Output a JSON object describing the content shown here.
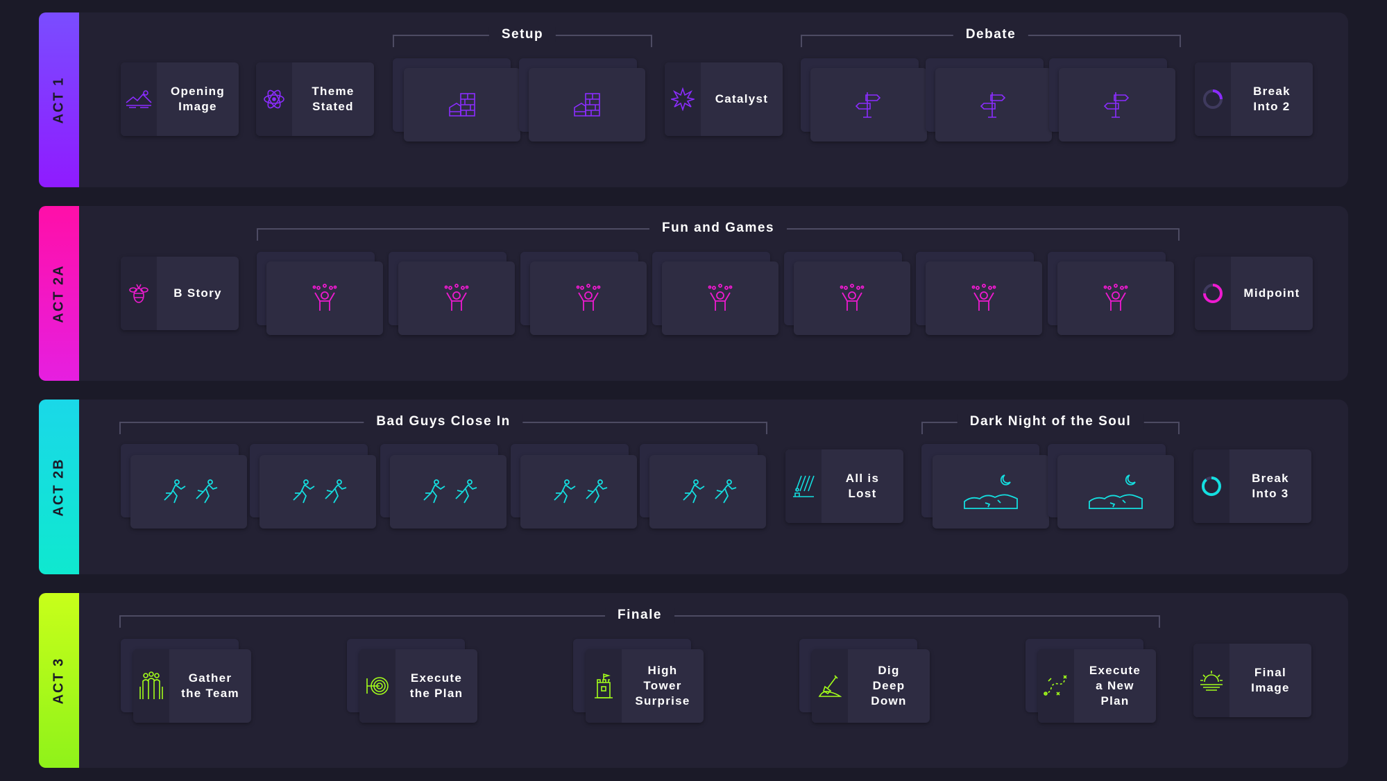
{
  "colors": {
    "background": "#1b1a28",
    "panel": "#232133",
    "card": "#2e2c42",
    "act1": "#8b2cff",
    "act2a": "#ee1ad0",
    "act2b": "#14dfe0",
    "act3": "#a3ff1a"
  },
  "acts": [
    {
      "label": "ACT 1"
    },
    {
      "label": "ACT 2A"
    },
    {
      "label": "ACT 2B"
    },
    {
      "label": "ACT 3"
    }
  ],
  "act1": {
    "groups": {
      "setup": "Setup",
      "debate": "Debate"
    },
    "beats": {
      "opening_image": "Opening\nImage",
      "theme_stated": "Theme\nStated",
      "catalyst": "Catalyst",
      "break_into_2": "Break\nInto 2"
    },
    "icons": {
      "opening_image": "landscape-icon",
      "theme_stated": "atom-icon",
      "setup": "bricks-icon",
      "catalyst": "burst-icon",
      "debate": "signpost-icon",
      "break_into_2": "ring-icon"
    }
  },
  "act2a": {
    "groups": {
      "fun_and_games": "Fun and Games"
    },
    "beats": {
      "b_story": "B Story",
      "midpoint": "Midpoint"
    },
    "icons": {
      "b_story": "bee-icon",
      "fun_and_games": "celebrating-person-icon",
      "midpoint": "ring-icon"
    }
  },
  "act2b": {
    "groups": {
      "bad_guys": "Bad Guys Close In",
      "dark_night": "Dark Night of the Soul"
    },
    "beats": {
      "all_is_lost": "All is\nLost",
      "break_into_3": "Break\nInto 3"
    },
    "icons": {
      "bad_guys": "running-figures-icon",
      "all_is_lost": "rain-person-icon",
      "dark_night": "moon-desert-icon",
      "break_into_3": "ring-icon"
    }
  },
  "act3": {
    "groups": {
      "finale": "Finale"
    },
    "beats": {
      "gather_the_team": "Gather\nthe Team",
      "execute_the_plan": "Execute\nthe Plan",
      "high_tower_surprise": "High\nTower\nSurprise",
      "dig_deep_down": "Dig\nDeep\nDown",
      "execute_new_plan": "Execute\na New\nPlan",
      "final_image": "Final\nImage"
    },
    "icons": {
      "gather_the_team": "team-icon",
      "execute_the_plan": "target-icon",
      "high_tower_surprise": "tower-icon",
      "dig_deep_down": "shovel-icon",
      "execute_new_plan": "strategy-icon",
      "final_image": "sunrise-icon"
    }
  }
}
